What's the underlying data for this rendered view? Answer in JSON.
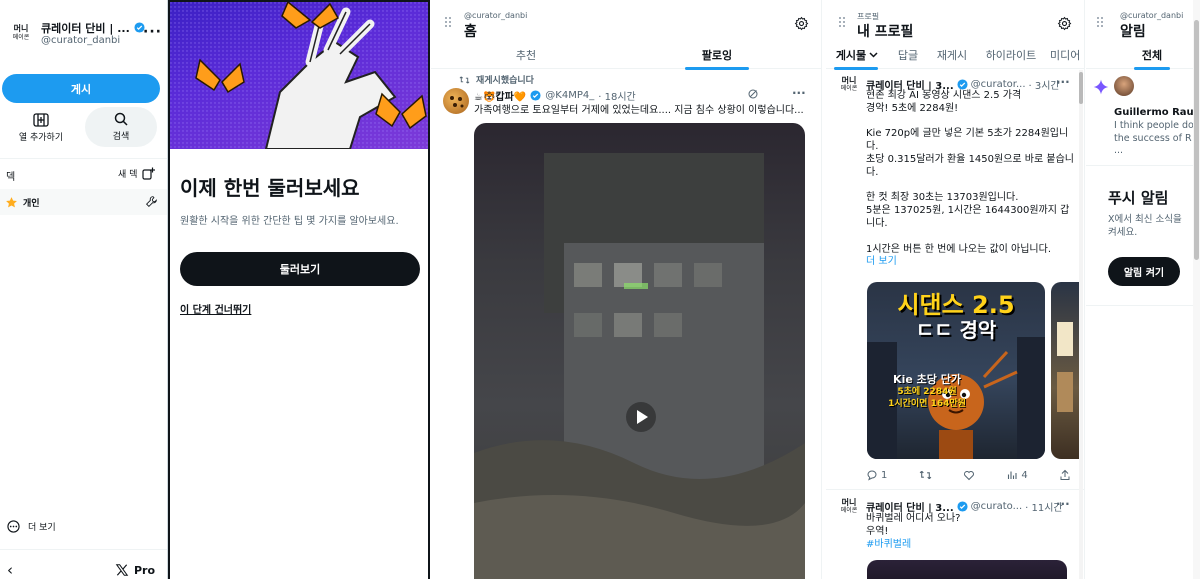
{
  "sidebar": {
    "account_name": "큐레이터 단비 | ...",
    "account_handle": "@curator_danbi",
    "logo_lines": [
      "머니",
      "메이콘"
    ],
    "post_button": "게시",
    "add_column_label": "열 추가하기",
    "search_label": "검색",
    "deck_label": "덱",
    "new_deck_label": "새 덱",
    "deck_item": "개인",
    "more_label": "더 보기",
    "pro_label": "Pro"
  },
  "onboarding": {
    "title": "이제 한번 둘러보세요",
    "subtitle": "원활한 시작을 위한 간단한 팁 몇 가지를 알아보세요.",
    "primary_button": "둘러보기",
    "skip_link": "이 단계 건너뛰기"
  },
  "home": {
    "handle": "@curator_danbi",
    "title": "홈",
    "tabs": [
      "추천",
      "팔로잉"
    ],
    "active_tab": 1,
    "retweet_label": "재게시했습니다",
    "tweet": {
      "name": "☕🐯캅파🧡",
      "handle": "@K4MP4_",
      "time": "· 18시간",
      "text": "가족여행으로 토요일부터 거제에 있었는데요.... 지금 침수 상황이 이렇습니다..."
    }
  },
  "profile": {
    "kicker": "프로필",
    "title": "내 프로필",
    "tabs": [
      "게시물",
      "답글",
      "재게시",
      "하이라이트",
      "미디어"
    ],
    "active_tab": 0,
    "tweet1": {
      "name": "큐레이터 단비 | 3...",
      "handle": "@curator...",
      "time": "· 3시간",
      "lines": [
        "현존 최강 AI 동영상 시댄스 2.5 가격",
        "경악! 5초에 2284원!",
        "",
        "Kie 720p에 글만 넣은 기본 5초가 2284원입니",
        "다.",
        "초당 0.315달러가 환율 1450원으로 바로 붙습니",
        "다.",
        "",
        "한 컷 최장 30초는 13703원입니다.",
        "5분은 137025원, 1시간은 1644300원까지 갑",
        "니다.",
        "",
        "1시간은 버튼 한 번에 나오는 값이 아닙니다."
      ],
      "more": "더 보기",
      "image_headline": "시댄스 2.5",
      "image_sub": "ㄷㄷ 경악",
      "image_caption1": "Kie 초당 단가",
      "image_caption2": "5초에 2284원",
      "image_caption3": "1시간이면 164만원",
      "replies": "1",
      "views": "4"
    },
    "tweet2": {
      "name": "큐레이터 단비 | 3...",
      "handle": "@curato...",
      "time": "· 11시간",
      "line1": "바퀴벌레 어디서 오나?",
      "line2": "우역!",
      "hashtag": "#바퀴벌레"
    }
  },
  "notifications": {
    "handle": "@curator_danbi",
    "title": "알림",
    "tab": "전체",
    "notif_name": "Guillermo Rauc",
    "notif_text_lines": [
      "I think people do",
      "the success of R",
      "..."
    ],
    "push_title": "푸시 알림",
    "push_text_lines": [
      "X에서 최신 소식을 ",
      "켜세요."
    ],
    "push_button": "알림 켜기"
  },
  "colors": {
    "accent": "#1d9bf0",
    "dark": "#0f1419",
    "muted": "#536471",
    "border": "#eff3f4"
  }
}
